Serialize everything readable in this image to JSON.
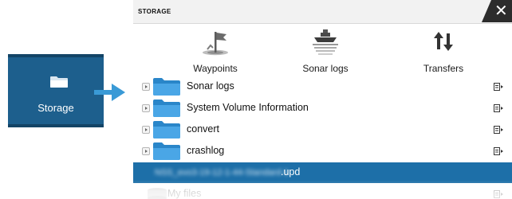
{
  "launcher": {
    "label": "Storage",
    "icon": "folder-icon",
    "color": "#1d5f8d"
  },
  "connector": {
    "icon": "arrow-right-icon",
    "color": "#3a9ad6"
  },
  "dialog": {
    "title": "STORAGE",
    "close_icon": "close-icon",
    "tools": [
      {
        "label": "Waypoints",
        "icon": "waypoint-flag-icon"
      },
      {
        "label": "Sonar logs",
        "icon": "boat-sonar-icon"
      },
      {
        "label": "Transfers",
        "icon": "transfer-arrows-icon"
      }
    ],
    "files": [
      {
        "name": "Sonar logs",
        "icon": "folder-icon"
      },
      {
        "name": "System Volume Information",
        "icon": "folder-icon"
      },
      {
        "name": "convert",
        "icon": "folder-icon"
      },
      {
        "name": "crashlog",
        "icon": "folder-icon"
      }
    ],
    "selected_file": {
      "blurred_name": "NSS_evo3-19-12-1-44-Standard-1",
      "extension": ".upd"
    },
    "faded_item": {
      "name": "My files",
      "icon": "drive-icon"
    },
    "accent": "#1d6fa8"
  }
}
